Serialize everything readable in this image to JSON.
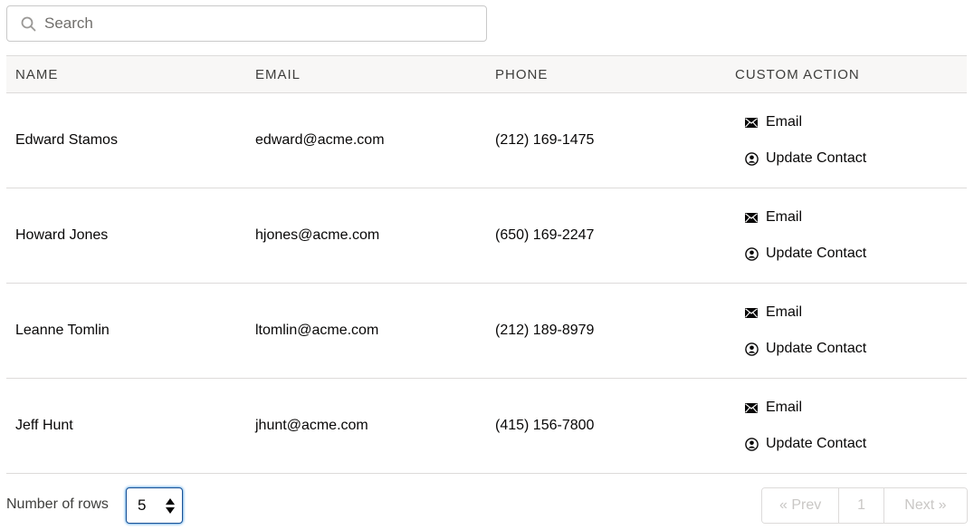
{
  "search": {
    "placeholder": "Search",
    "value": ""
  },
  "table": {
    "headers": {
      "name": "NAME",
      "email": "EMAIL",
      "phone": "PHONE",
      "action": "CUSTOM ACTION"
    },
    "rows": [
      {
        "name": "Edward Stamos",
        "email": "edward@acme.com",
        "phone": "(212) 169-1475"
      },
      {
        "name": "Howard Jones",
        "email": "hjones@acme.com",
        "phone": "(650) 169-2247"
      },
      {
        "name": "Leanne Tomlin",
        "email": "ltomlin@acme.com",
        "phone": "(212) 189-8979"
      },
      {
        "name": "Jeff Hunt",
        "email": "jhunt@acme.com",
        "phone": "(415) 156-7800"
      }
    ],
    "actions": {
      "email_label": "Email",
      "update_label": "Update Contact"
    }
  },
  "footer": {
    "rows_label": "Number of rows",
    "rows_value": "5",
    "prev_label": "« Prev",
    "page_label": "1",
    "next_label": "Next »"
  },
  "icons": {
    "search": "search-icon",
    "email": "envelope-icon",
    "update": "user-circle-icon",
    "stepper": "stepper-arrows-icon"
  },
  "colors": {
    "focus_border": "#1b5297",
    "header_bg": "#f8f7f6",
    "disabled_text": "#c9c7c5"
  }
}
